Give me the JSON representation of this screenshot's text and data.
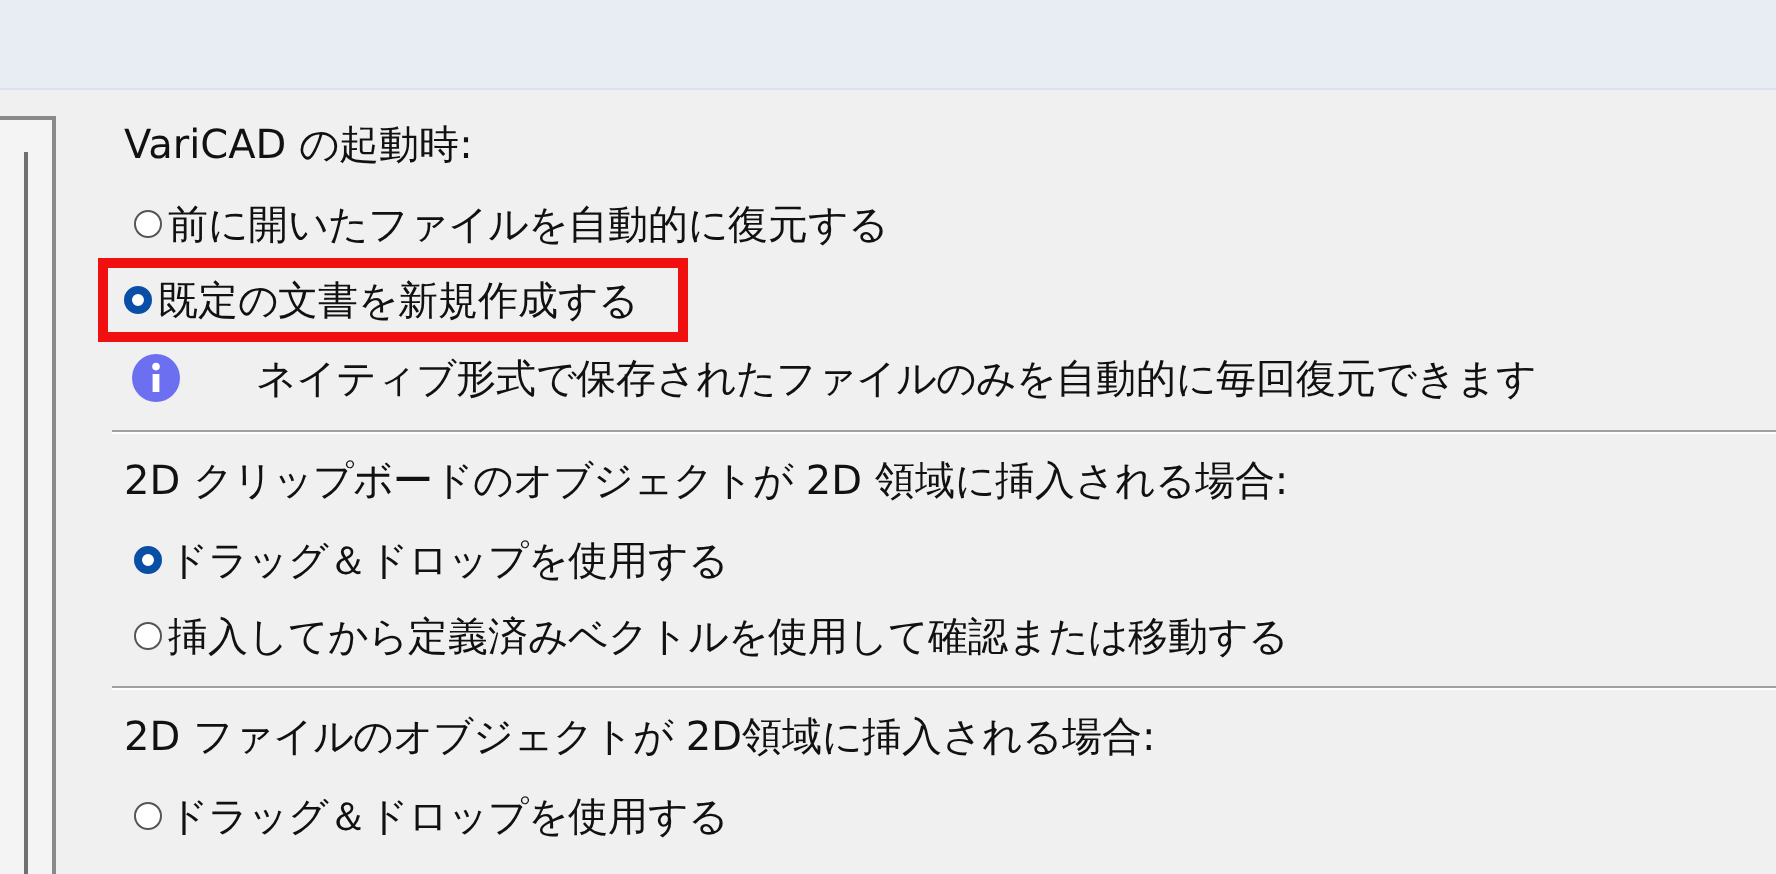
{
  "sections": [
    {
      "heading": "VariCAD の起動時:",
      "options": [
        {
          "label": "前に開いたファイルを自動的に復元する",
          "selected": false,
          "highlighted": false
        },
        {
          "label": "既定の文書を新規作成する",
          "selected": true,
          "highlighted": true
        }
      ],
      "note": "ネイティブ形式で保存されたファイルのみを自動的に毎回復元できます"
    },
    {
      "heading": "2D クリップボードのオブジェクトが 2D 領域に挿入される場合:",
      "options": [
        {
          "label": "ドラッグ＆ドロップを使用する",
          "selected": true,
          "highlighted": false
        },
        {
          "label": "挿入してから定義済みベクトルを使用して確認または移動する",
          "selected": false,
          "highlighted": false
        }
      ]
    },
    {
      "heading": "2D ファイルのオブジェクトが 2D領域に挿入される場合:",
      "options": [
        {
          "label": "ドラッグ＆ドロップを使用する",
          "selected": false,
          "highlighted": false
        }
      ]
    }
  ]
}
